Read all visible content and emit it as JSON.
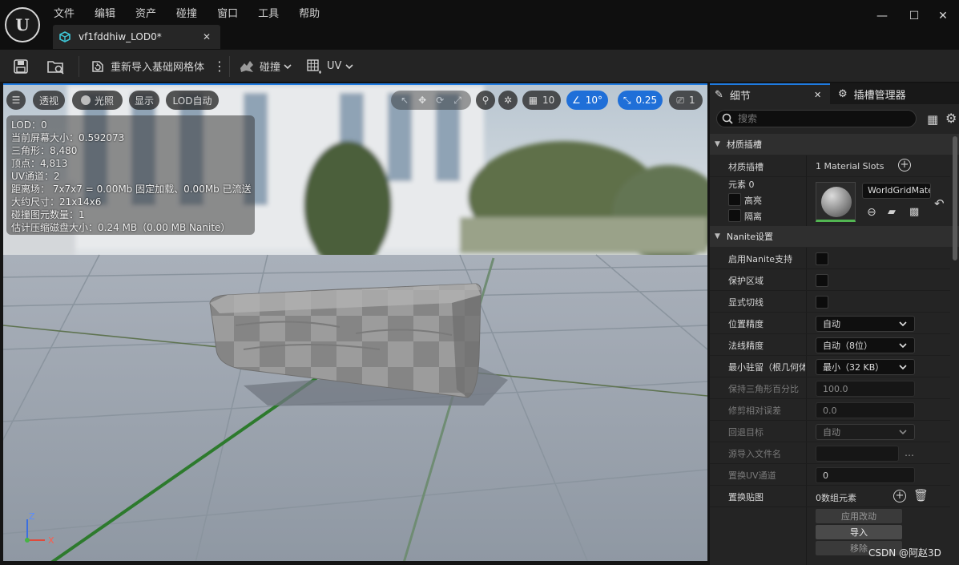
{
  "app": {
    "menu": [
      "文件",
      "编辑",
      "资产",
      "碰撞",
      "窗口",
      "工具",
      "帮助"
    ],
    "document_tab": "vf1fddhiw_LOD0*"
  },
  "toolbar": {
    "reimport_label": "重新导入基础网格体",
    "collision_label": "碰撞",
    "uv_label": "UV"
  },
  "viewport": {
    "perspective_label": "透视",
    "lighting_label": "光照",
    "show_label": "显示",
    "lod_label": "LOD自动",
    "grid_size": "10",
    "rotation_snap": "10°",
    "scale_snap": "0.25",
    "camera_speed": "1",
    "axis_labels": {
      "z": "Z",
      "x": "X"
    },
    "stats": [
      "LOD：0",
      "当前屏幕大小：0.592073",
      "三角形：8,480",
      "顶点：4,813",
      "UV通道：2",
      "距离场： 7x7x7 = 0.00Mb 固定加载、0.00Mb 已流送",
      "大约尺寸：21x14x6",
      "碰撞图元数量：1",
      "估计压缩磁盘大小：0.24 MB（0.00 MB Nanite）"
    ]
  },
  "details": {
    "tab_details": "细节",
    "tab_sockets": "插槽管理器",
    "search_placeholder": "搜索",
    "material_section": "材质插槽",
    "material_slots_label": "材质插槽",
    "material_slots_value": "1 Material Slots",
    "element_label": "元素 0",
    "highlight_label": "高亮",
    "isolate_label": "隔离",
    "material_name": "WorldGridMater",
    "nanite_section": "Nanite设置",
    "rows": {
      "enable_nanite": "启用Nanite支持",
      "preserve_area": "保护区域",
      "explicit_tangents": "显式切线",
      "position_precision": "位置精度",
      "position_precision_value": "自动",
      "normal_precision": "法线精度",
      "normal_precision_value": "自动（8位）",
      "min_residency": "最小驻留（根几何体",
      "min_residency_value": "最小（32 KB）",
      "keep_percent": "保持三角形百分比",
      "keep_percent_value": "100.0",
      "trim_error": "修剪相对误差",
      "trim_error_value": "0.0",
      "fallback_target": "回退目标",
      "fallback_target_value": "自动",
      "source_import": "源导入文件名",
      "source_import_value": "",
      "replace_uv": "置换UV通道",
      "replace_uv_value": "0",
      "displacement_maps": "置换贴图",
      "displacement_maps_value": "0数组元素"
    },
    "apply_button": "应用改动",
    "import_button": "导入",
    "remove_button": "移除",
    "watermark": "CSDN @阿赵3D"
  }
}
